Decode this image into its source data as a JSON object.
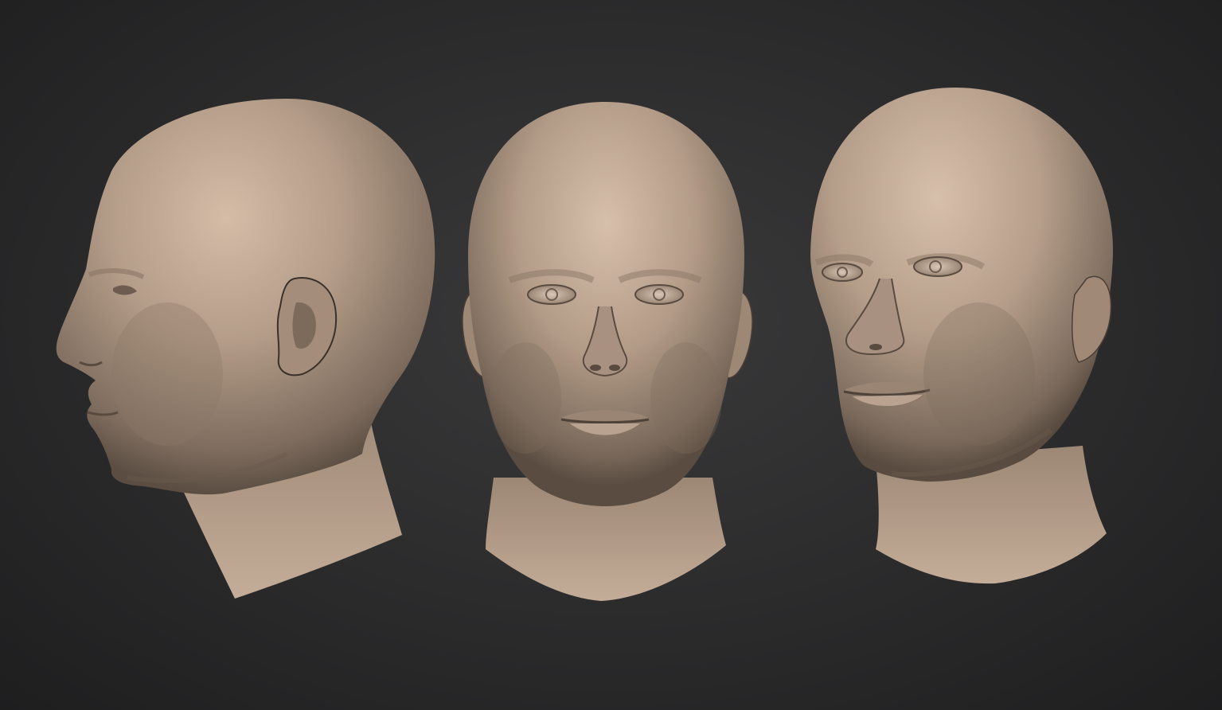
{
  "scene": {
    "description_visible_text": "",
    "colors": {
      "background_center": "#3a3a3b",
      "background_edge": "#1e1e1f",
      "clay_light": "#cdb5a0",
      "clay_mid": "#a8927f",
      "clay_dark": "#6e5e51",
      "clay_shadow": "#4a3f37"
    },
    "views": [
      {
        "id": "side",
        "icon": "head-profile-view"
      },
      {
        "id": "front",
        "icon": "head-front-view"
      },
      {
        "id": "three-quarter",
        "icon": "head-three-quarter-view"
      }
    ]
  }
}
